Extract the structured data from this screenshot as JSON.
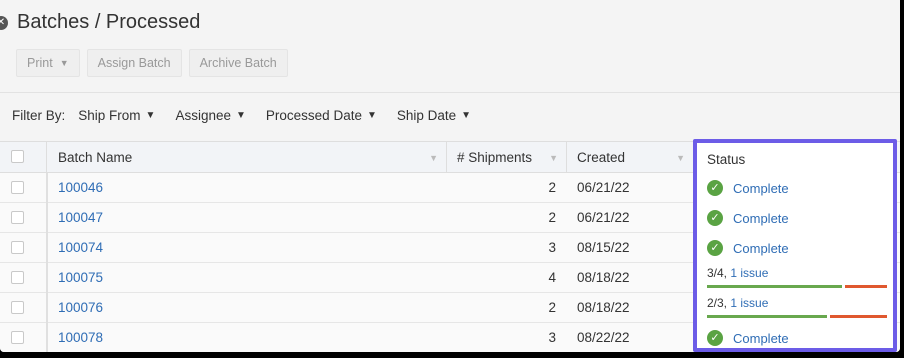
{
  "page": {
    "title": "Batches / Processed"
  },
  "toolbar": {
    "print_label": "Print",
    "assign_label": "Assign Batch",
    "archive_label": "Archive Batch"
  },
  "filters": {
    "label": "Filter By:",
    "items": [
      "Ship From",
      "Assignee",
      "Processed Date",
      "Ship Date"
    ]
  },
  "table": {
    "columns": {
      "batch_name": "Batch Name",
      "shipments": "# Shipments",
      "created": "Created",
      "status": "Status"
    },
    "rows": [
      {
        "batch_name": "100046",
        "shipments": "2",
        "created": "06/21/22",
        "status": {
          "type": "complete",
          "text": "Complete"
        }
      },
      {
        "batch_name": "100047",
        "shipments": "2",
        "created": "06/21/22",
        "status": {
          "type": "complete",
          "text": "Complete"
        }
      },
      {
        "batch_name": "100074",
        "shipments": "3",
        "created": "08/15/22",
        "status": {
          "type": "complete",
          "text": "Complete"
        }
      },
      {
        "batch_name": "100075",
        "shipments": "4",
        "created": "08/18/22",
        "status": {
          "type": "partial",
          "count": "3/4,",
          "issue": "1 issue",
          "fraction": 0.75
        }
      },
      {
        "batch_name": "100076",
        "shipments": "2",
        "created": "08/18/22",
        "status": {
          "type": "partial",
          "count": "2/3,",
          "issue": "1 issue",
          "fraction": 0.667
        }
      },
      {
        "batch_name": "100078",
        "shipments": "3",
        "created": "08/22/22",
        "status": {
          "type": "complete",
          "text": "Complete"
        }
      }
    ]
  },
  "colors": {
    "link": "#2f6db5",
    "complete_green": "#5aa343",
    "progress_ok": "#68a84e",
    "progress_error": "#e0582f",
    "highlight_border": "#6c5ce7"
  },
  "icons": {
    "complete": "check-circle-icon",
    "caret": "caret-down-icon"
  }
}
